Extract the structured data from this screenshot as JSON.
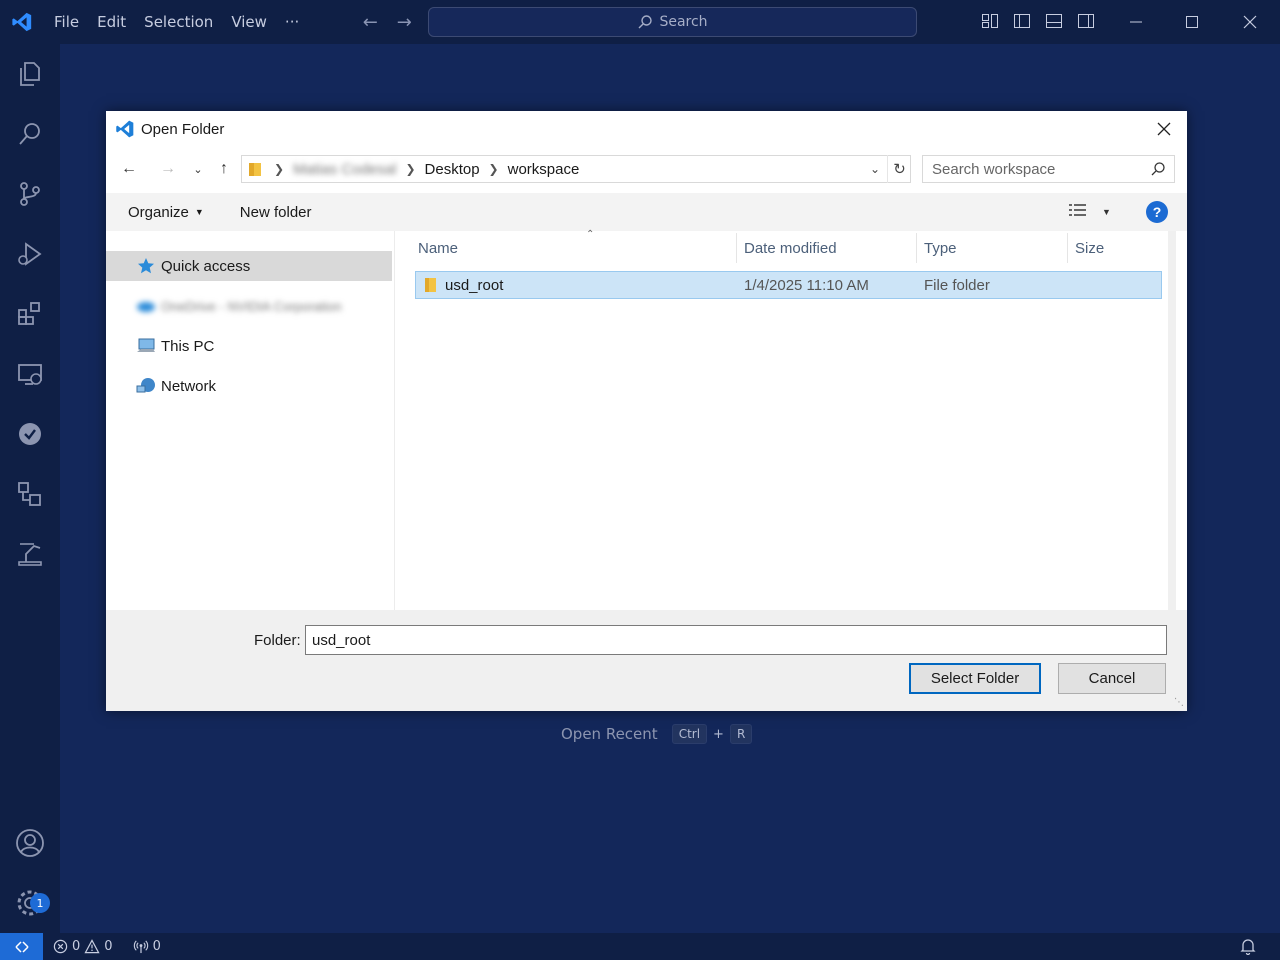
{
  "titlebar": {
    "menu": [
      "File",
      "Edit",
      "Selection",
      "View",
      "···"
    ],
    "search_placeholder": "Search"
  },
  "activity_bar": {
    "items": [
      "explorer-icon",
      "search-icon",
      "source-control-icon",
      "run-debug-icon",
      "extensions-icon",
      "remote-explorer-icon",
      "testing-icon",
      "containers-icon",
      "robot-arm-icon"
    ],
    "bottom": [
      "account-icon",
      "manage-gear-icon"
    ],
    "manage_badge": "1"
  },
  "welcome": {
    "open_recent_label": "Open Recent",
    "keys": [
      "Ctrl",
      "+",
      "R"
    ]
  },
  "statusbar": {
    "errors": "0",
    "warnings": "0",
    "ports": "0"
  },
  "dialog": {
    "title": "Open Folder",
    "breadcrumb": [
      "Matias Codesal",
      "Desktop",
      "workspace"
    ],
    "search_placeholder": "Search workspace",
    "toolbar": {
      "organize": "Organize",
      "new_folder": "New folder"
    },
    "nav": [
      {
        "label": "Quick access",
        "icon": "star-icon",
        "selected": true
      },
      {
        "label": "OneDrive - NVIDIA Corporation",
        "icon": "cloud-icon",
        "blurred": true
      },
      {
        "label": "This PC",
        "icon": "computer-icon"
      },
      {
        "label": "Network",
        "icon": "network-icon"
      }
    ],
    "columns": [
      "Name",
      "Date modified",
      "Type",
      "Size"
    ],
    "files": [
      {
        "name": "usd_root",
        "date": "1/4/2025 11:10 AM",
        "type": "File folder",
        "size": ""
      }
    ],
    "footer": {
      "folder_label": "Folder:",
      "folder_value": "usd_root",
      "select_button": "Select Folder",
      "cancel_button": "Cancel"
    }
  },
  "colors": {
    "background": "#0f1f45",
    "editor": "#13275a",
    "accent": "#1e6bd6",
    "selection": "#cce4f7"
  }
}
